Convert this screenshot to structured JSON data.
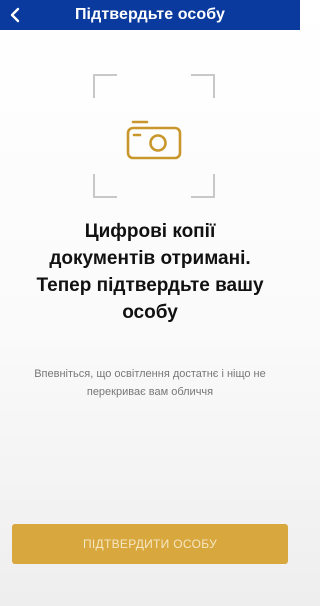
{
  "header": {
    "title": "Підтвердьте особу",
    "back_icon": "chevron-left-icon"
  },
  "main": {
    "camera_icon": "camera-icon",
    "heading_line1": "Цифрові копії",
    "heading_line2": "документів отримані.",
    "heading_line3": "Тепер підтвердьте вашу",
    "heading_line4": "особу",
    "hint_line1": "Впевніться, що освітлення достатнє і ніщо не",
    "hint_line2": "перекриває вам обличчя"
  },
  "footer": {
    "confirm_label": "ПІДТВЕРДИТИ ОСОБУ"
  },
  "colors": {
    "header_bg": "#0a3a9e",
    "accent": "#d8a73e",
    "icon_color": "#c8962a"
  }
}
